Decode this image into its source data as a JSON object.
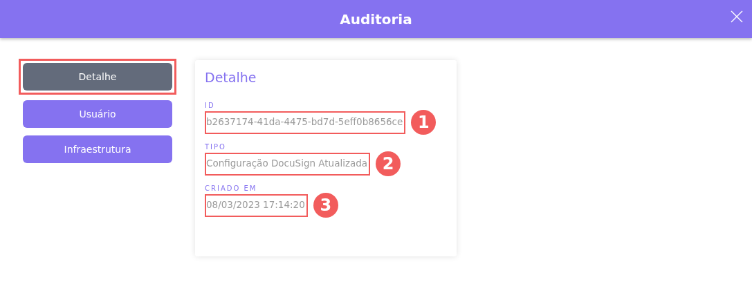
{
  "window": {
    "title": "Auditoria"
  },
  "tabs": [
    {
      "label": "Detalhe",
      "selected": true,
      "highlighted": true
    },
    {
      "label": "Usuário",
      "selected": false,
      "highlighted": false
    },
    {
      "label": "Infraestrutura",
      "selected": false,
      "highlighted": false
    }
  ],
  "detail": {
    "title": "Detalhe",
    "fields": [
      {
        "label": "ID",
        "value": "b2637174-41da-4475-bd7d-5eff0b8656ce",
        "annotation": "1"
      },
      {
        "label": "TIPO",
        "value": "Configuração DocuSign Atualizada",
        "annotation": "2"
      },
      {
        "label": "CRIADO EM",
        "value": "08/03/2023 17:14:20",
        "annotation": "3"
      }
    ]
  }
}
